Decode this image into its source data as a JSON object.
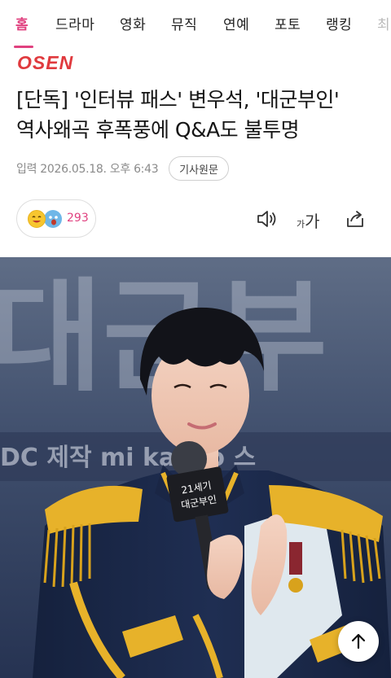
{
  "nav": {
    "items": [
      "홈",
      "드라마",
      "영화",
      "뮤직",
      "연예",
      "포토",
      "랭킹",
      "최"
    ],
    "active_index": 0
  },
  "brand": {
    "logo_text": "OSEN",
    "color": "#e03a3e"
  },
  "article": {
    "headline_line1": "[단독] '인터뷰 패스' 변우석, '대군부인'",
    "headline_line2": "역사왜곡 후폭풍에 Q&A도 불투명",
    "published": "입력 2026.05.18. 오후 6:43",
    "original_label": "기사원문"
  },
  "reaction": {
    "count": "293"
  },
  "toolbar": {
    "font_size_small": "가",
    "font_size_large": "가"
  },
  "photo": {
    "background_text": "대군부",
    "sponsors_text": "DC  제작  mi   kakao  스",
    "mic_text_line1": "21세기",
    "mic_text_line2": "대군부인"
  },
  "colors": {
    "accent": "#e0417f",
    "uniform": "#1c2a4a",
    "gold": "#e7b22a"
  }
}
